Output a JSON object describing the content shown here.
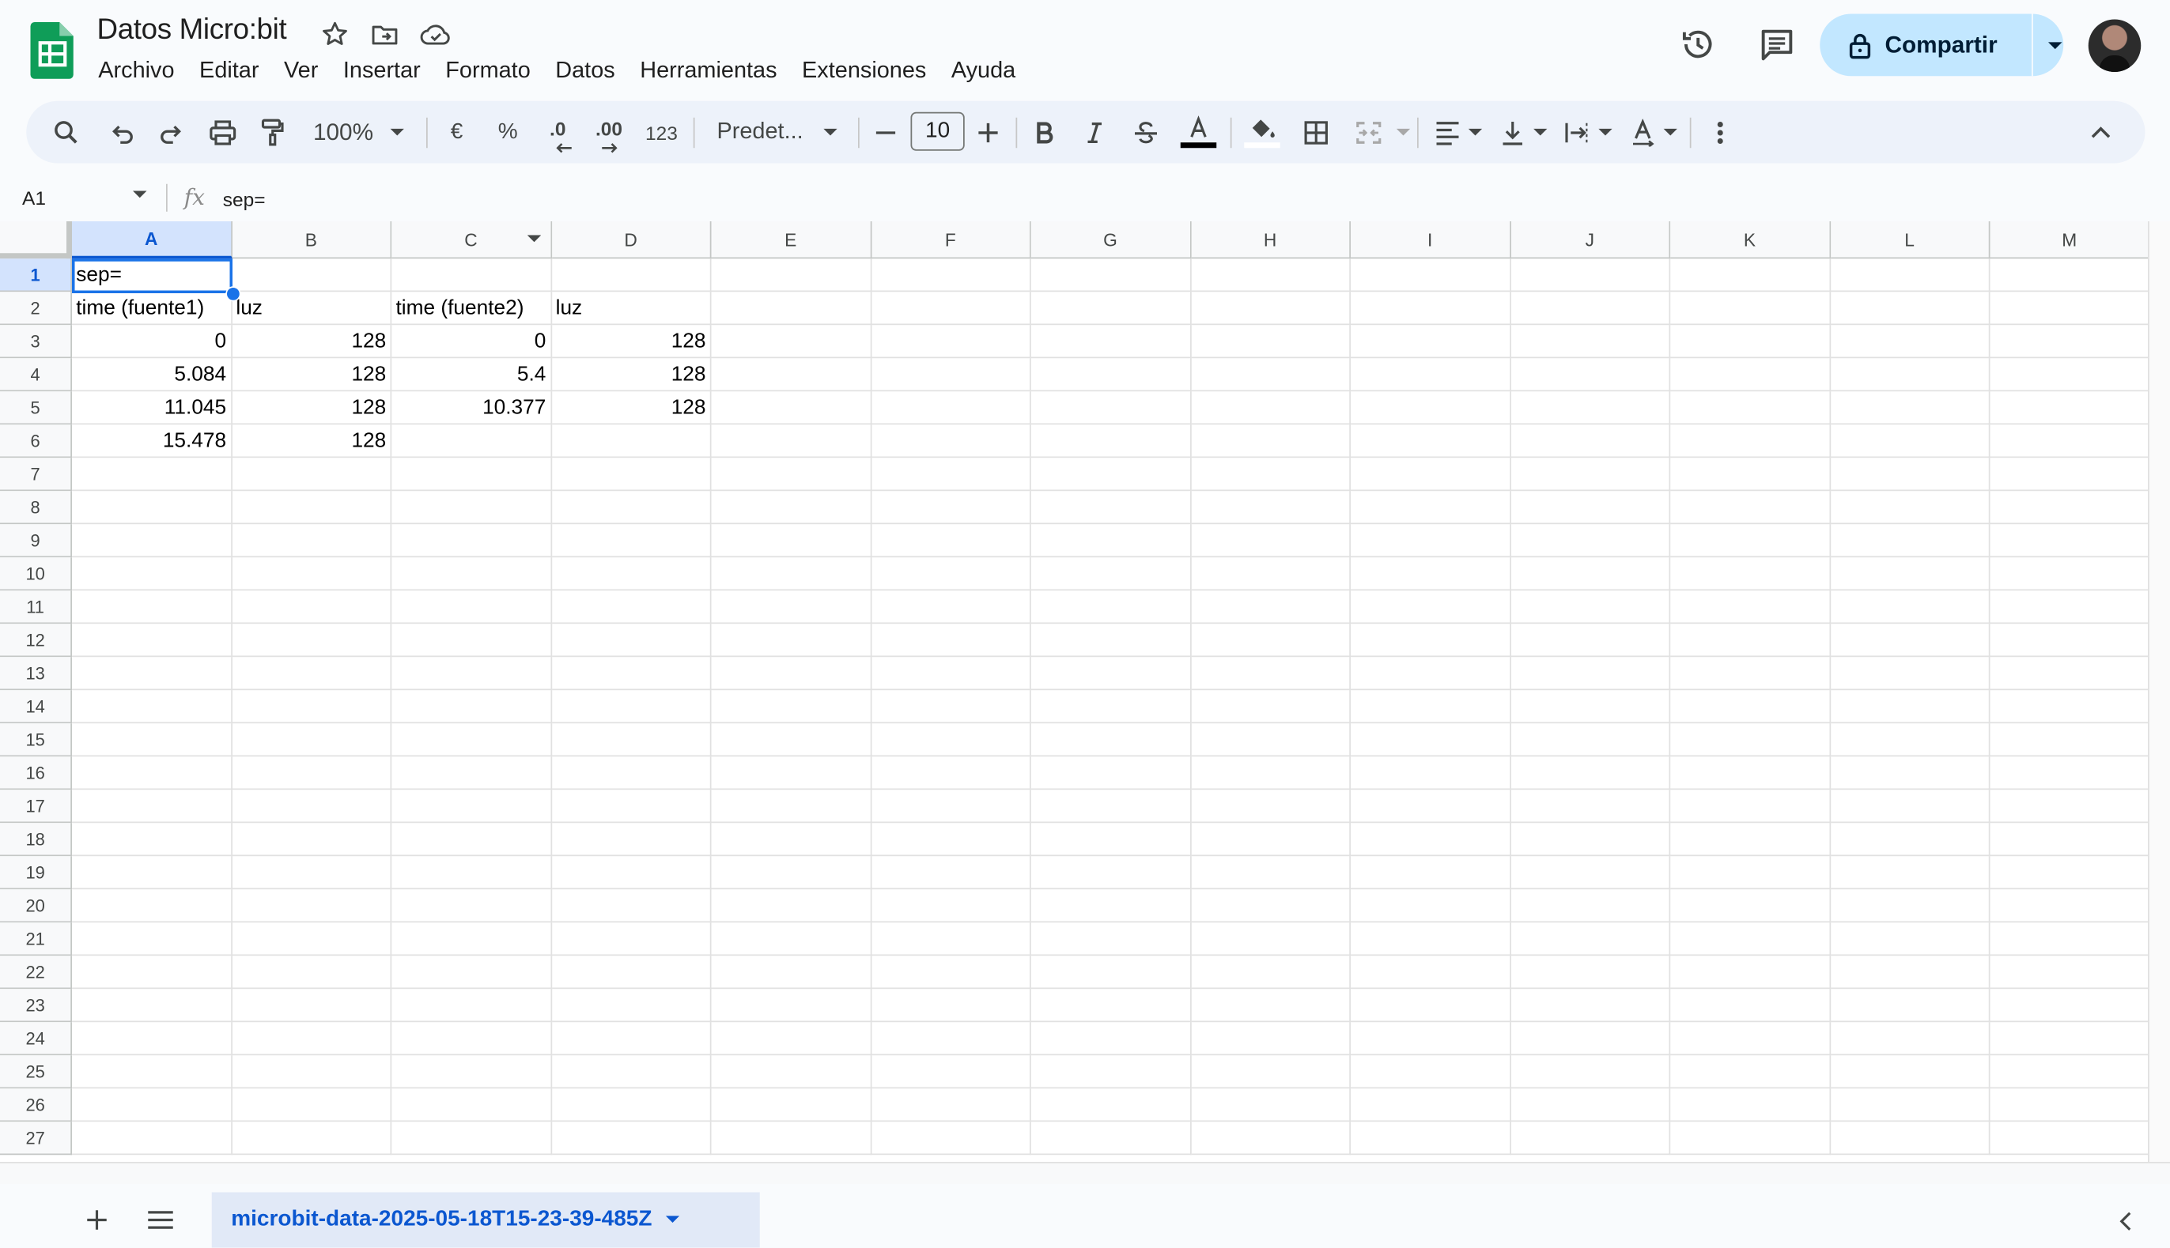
{
  "app": {
    "title": "Datos Micro:bit",
    "menus": [
      "Archivo",
      "Editar",
      "Ver",
      "Insertar",
      "Formato",
      "Datos",
      "Herramientas",
      "Extensiones",
      "Ayuda"
    ],
    "share_label": "Compartir",
    "brand_color": "#0f9d58",
    "accent_color": "#0b57d0"
  },
  "toolbar": {
    "zoom": "100%",
    "currency": "€",
    "percent": "%",
    "dec_decrease": ".0",
    "dec_increase": ".00",
    "number_format": "123",
    "font": "Predet...",
    "font_size": "10"
  },
  "formula_bar": {
    "cell_ref": "A1",
    "fx": "fx",
    "content": "sep="
  },
  "grid": {
    "columns": [
      "A",
      "B",
      "C",
      "D",
      "E",
      "F",
      "G",
      "H",
      "I",
      "J",
      "K",
      "L",
      "M"
    ],
    "row_count": 27,
    "selected_cell": "A1",
    "rows": [
      [
        "sep=",
        "",
        "",
        ""
      ],
      [
        "time (fuente1)",
        "luz",
        "time (fuente2)",
        "luz"
      ],
      [
        "0",
        "128",
        "0",
        "128"
      ],
      [
        "5.084",
        "128",
        "5.4",
        "128"
      ],
      [
        "11.045",
        "128",
        "10.377",
        "128"
      ],
      [
        "15.478",
        "128",
        "",
        ""
      ]
    ],
    "numeric_rows_from": 3
  },
  "sheets": {
    "active": "microbit-data-2025-05-18T15-23-39-485Z"
  }
}
